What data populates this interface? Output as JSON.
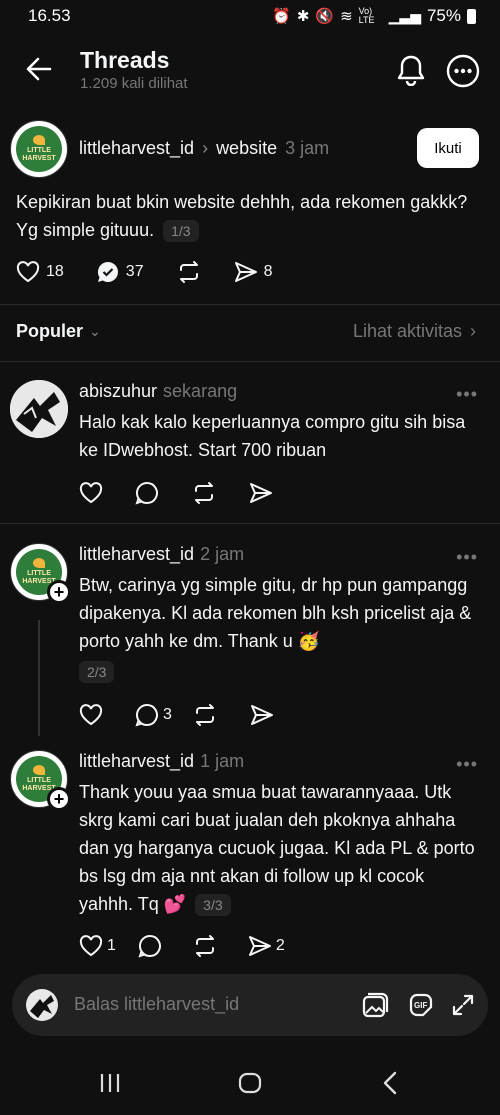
{
  "status_bar": {
    "time": "16.53",
    "battery": "75%",
    "net": "Vo) LTE"
  },
  "header": {
    "title": "Threads",
    "views": "1.209 kali dilihat"
  },
  "post": {
    "author": "littleharvest_id",
    "topic": "website",
    "time": "3 jam",
    "follow_label": "Ikuti",
    "text": "Kepikiran buat bkin website dehhh, ada rekomen gakkk? Yg simple gituuu.",
    "page": "1/3",
    "likes": "18",
    "replies": "37",
    "shares": "8"
  },
  "sort": {
    "label": "Populer",
    "activity": "Lihat aktivitas"
  },
  "logo_text": [
    "LITTLE",
    "HARVEST"
  ],
  "replies": [
    {
      "author": "abiszuhur",
      "time": "sekarang",
      "text": "Halo kak kalo keperluannya compro gitu sih bisa ke IDwebhost. Start 700 ribuan"
    },
    {
      "author": "littleharvest_id",
      "time": "2 jam",
      "text": "Btw, carinya yg simple gitu, dr hp pun gampangg dipakenya. Kl ada rekomen blh ksh pricelist aja & porto yahh ke dm. Thank u 🥳",
      "page": "2/3",
      "comments": "3"
    },
    {
      "author": "littleharvest_id",
      "time": "1 jam",
      "text": "Thank youu yaa smua buat tawarannyaaa. Utk skrg kami cari buat jualan deh pkoknya ahhaha dan yg harganya cucuok jugaa. Kl ada PL & porto bs lsg dm aja nnt akan di follow up kl cocok yahhh. Tq 💕",
      "page": "3/3",
      "likes": "1",
      "shares": "2"
    }
  ],
  "reply_bar": {
    "placeholder": "Balas littleharvest_id"
  }
}
